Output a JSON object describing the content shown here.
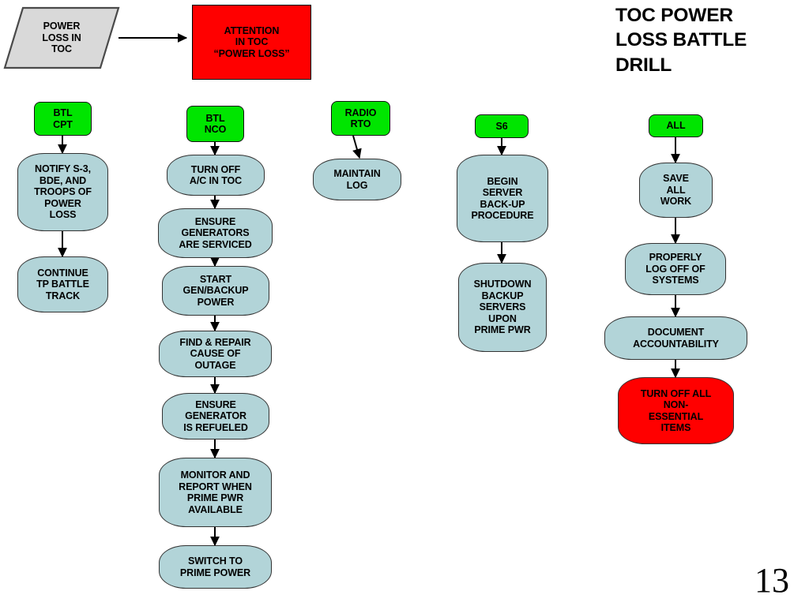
{
  "title": "TOC POWER\nLOSS BATTLE\nDRILL",
  "page_number": "13",
  "colors": {
    "process_fill": "#B2D4D8",
    "role_fill": "#00E500",
    "alert_fill": "#FF0000",
    "input_fill": "#D9D9D9",
    "border": "#333333",
    "text": "#000000"
  },
  "trigger": {
    "input_label": "POWER\nLOSS IN\nTOC",
    "alert_label": "ATTENTION\nIN TOC\n“POWER LOSS”"
  },
  "columns": [
    {
      "id": "btl-cpt",
      "role": "BTL\nCPT",
      "steps": [
        {
          "label": "NOTIFY S-3,\nBDE, AND\nTROOPS OF\nPOWER\nLOSS",
          "kind": "process"
        },
        {
          "label": "CONTINUE\nTP BATTLE\nTRACK",
          "kind": "process"
        }
      ]
    },
    {
      "id": "btl-nco",
      "role": "BTL\nNCO",
      "steps": [
        {
          "label": "TURN OFF\nA/C IN TOC",
          "kind": "process"
        },
        {
          "label": "ENSURE\nGENERATORS\nARE SERVICED",
          "kind": "process"
        },
        {
          "label": "START\nGEN/BACKUP\nPOWER",
          "kind": "process"
        },
        {
          "label": "FIND & REPAIR\nCAUSE OF\nOUTAGE",
          "kind": "process"
        },
        {
          "label": "ENSURE\nGENERATOR\nIS REFUELED",
          "kind": "process"
        },
        {
          "label": "MONITOR AND\nREPORT WHEN\nPRIME PWR\nAVAILABLE",
          "kind": "process"
        },
        {
          "label": "SWITCH TO\nPRIME POWER",
          "kind": "process"
        }
      ]
    },
    {
      "id": "radio-rto",
      "role": "RADIO\nRTO",
      "steps": [
        {
          "label": "MAINTAIN\nLOG",
          "kind": "process"
        }
      ]
    },
    {
      "id": "s6",
      "role": "S6",
      "steps": [
        {
          "label": "BEGIN\nSERVER\nBACK-UP\nPROCEDURE",
          "kind": "process"
        },
        {
          "label": "SHUTDOWN\nBACKUP\nSERVERS\nUPON\nPRIME PWR",
          "kind": "process"
        }
      ]
    },
    {
      "id": "all",
      "role": "ALL",
      "steps": [
        {
          "label": "SAVE\nALL\nWORK",
          "kind": "process"
        },
        {
          "label": "PROPERLY\nLOG OFF OF\nSYSTEMS",
          "kind": "process"
        },
        {
          "label": "DOCUMENT\nACCOUNTABILITY",
          "kind": "process"
        },
        {
          "label": "TURN OFF ALL\nNON-\nESSENTIAL\nITEMS",
          "kind": "alert"
        }
      ]
    }
  ]
}
